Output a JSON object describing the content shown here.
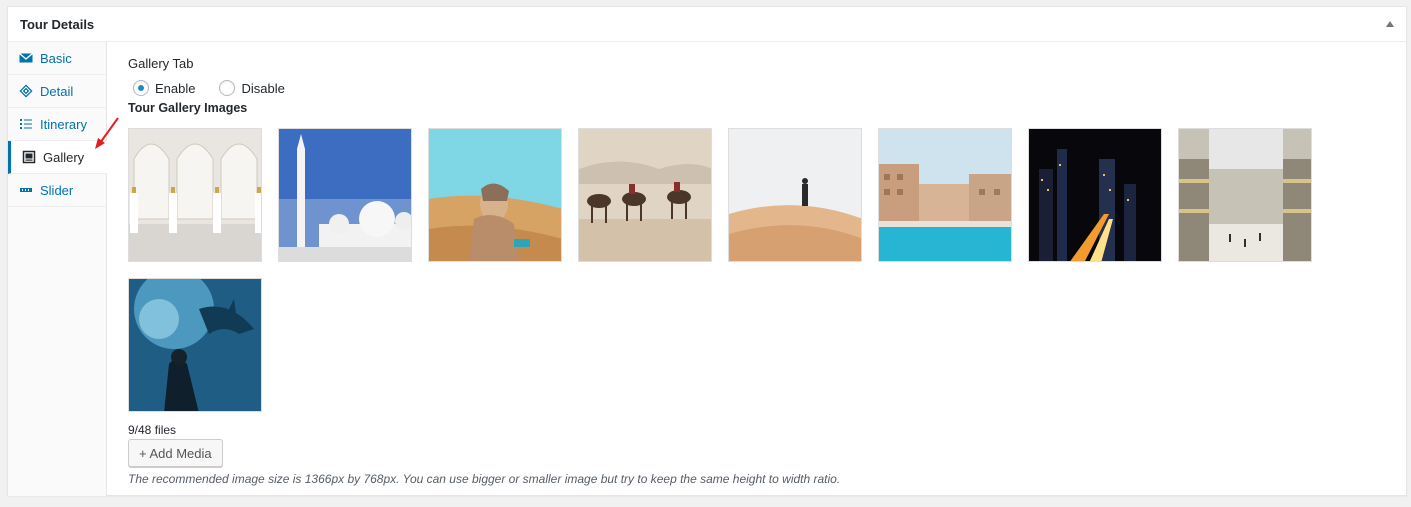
{
  "metabox": {
    "title": "Tour Details"
  },
  "tabs": [
    {
      "label": "Basic",
      "icon": "envelope-icon"
    },
    {
      "label": "Detail",
      "icon": "tag-icon"
    },
    {
      "label": "Itinerary",
      "icon": "list-icon"
    },
    {
      "label": "Gallery",
      "icon": "gallery-icon",
      "active": true
    },
    {
      "label": "Slider",
      "icon": "slider-icon"
    }
  ],
  "gallery_tab": {
    "label": "Gallery Tab",
    "options": [
      {
        "label": "Enable",
        "checked": true
      },
      {
        "label": "Disable",
        "checked": false
      }
    ]
  },
  "gallery_images": {
    "label": "Tour Gallery Images",
    "images": [
      "mosque-arches",
      "white-mosque-minaret",
      "woman-in-desert",
      "camel-caravan",
      "woman-on-dune",
      "waterfront-pool",
      "city-night-skyline",
      "shopping-mall-interior",
      "aquarium-shark"
    ],
    "count_text": "9/48 files",
    "add_button": "+ Add Media",
    "hint": "The recommended image size is 1366px by 768px. You can use bigger or smaller image but try to keep the same height to width ratio."
  },
  "colors": {
    "accent": "#0073aa",
    "annotation_arrow": "#e02020"
  }
}
